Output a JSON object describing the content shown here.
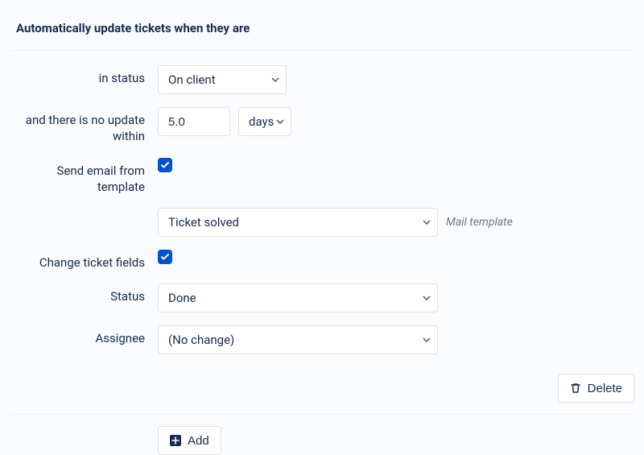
{
  "section_title": "Automatically update tickets when they are",
  "labels": {
    "in_status": "in status",
    "no_update": "and there is no update within",
    "send_email": "Send email from template",
    "change_fields": "Change ticket fields",
    "status": "Status",
    "assignee": "Assignee"
  },
  "values": {
    "status_filter": "On client",
    "duration_value": "5.0",
    "duration_unit": "days",
    "mail_template": "Ticket solved",
    "new_status": "Done",
    "assignee": "(No change)"
  },
  "meta": {
    "mail_template_hint": "Mail template"
  },
  "buttons": {
    "delete": "Delete",
    "add": "Add"
  }
}
